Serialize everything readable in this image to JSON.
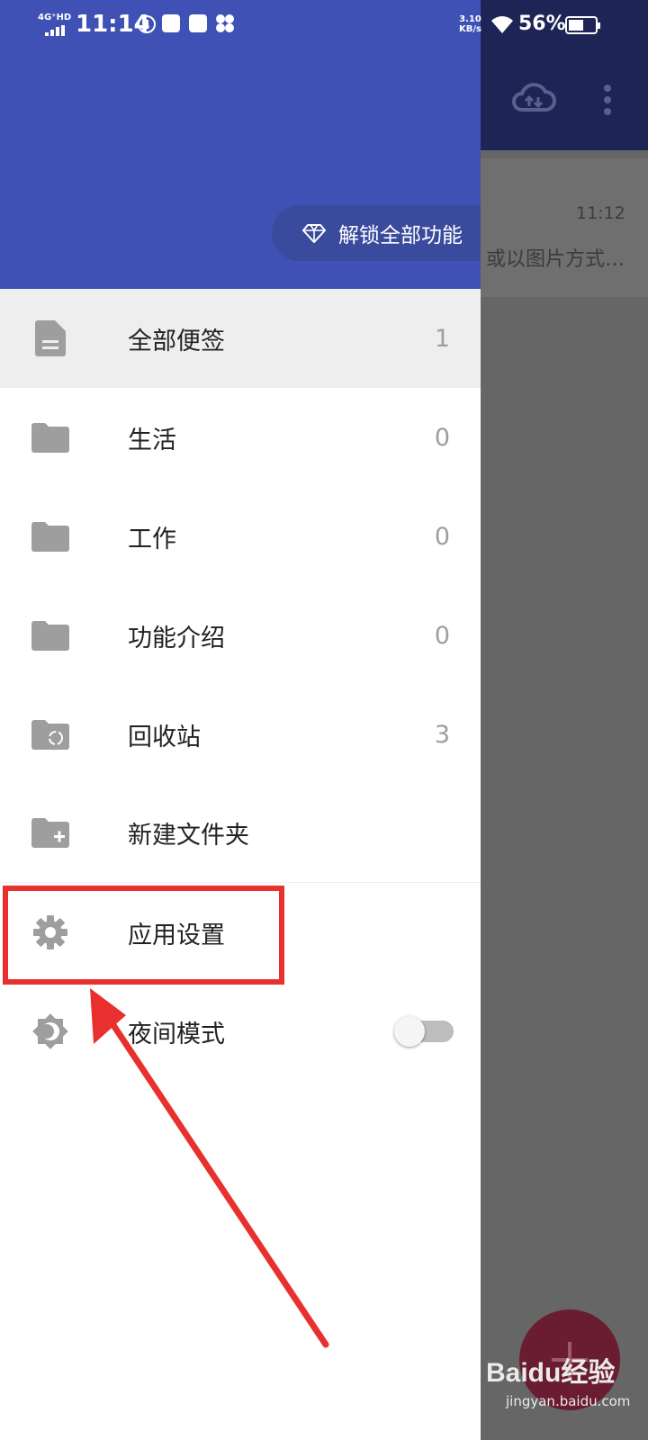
{
  "status_bar": {
    "network": "4G⁺HD",
    "time": "11:14",
    "speed": "3.10\nKB/s",
    "battery": "56%"
  },
  "background_app": {
    "note_time": "11:12",
    "note_snippet": "或以图片方式…"
  },
  "drawer": {
    "unlock_label": "解锁全部功能",
    "items": [
      {
        "label": "全部便签",
        "count": "1",
        "icon": "note-icon"
      },
      {
        "label": "生活",
        "count": "0",
        "icon": "folder-icon"
      },
      {
        "label": "工作",
        "count": "0",
        "icon": "folder-icon"
      },
      {
        "label": "功能介绍",
        "count": "0",
        "icon": "folder-icon"
      },
      {
        "label": "回收站",
        "count": "3",
        "icon": "recycle-folder-icon"
      },
      {
        "label": "新建文件夹",
        "icon": "new-folder-icon"
      },
      {
        "label": "应用设置",
        "icon": "gear-icon"
      },
      {
        "label": "夜间模式",
        "icon": "night-mode-icon",
        "toggle_on": false
      }
    ]
  },
  "watermark": {
    "logo": "Baidu经验",
    "site": "jingyan.baidu.com"
  },
  "colors": {
    "drawer_header": "#3f51b5",
    "annotation_red": "#e8302e"
  }
}
